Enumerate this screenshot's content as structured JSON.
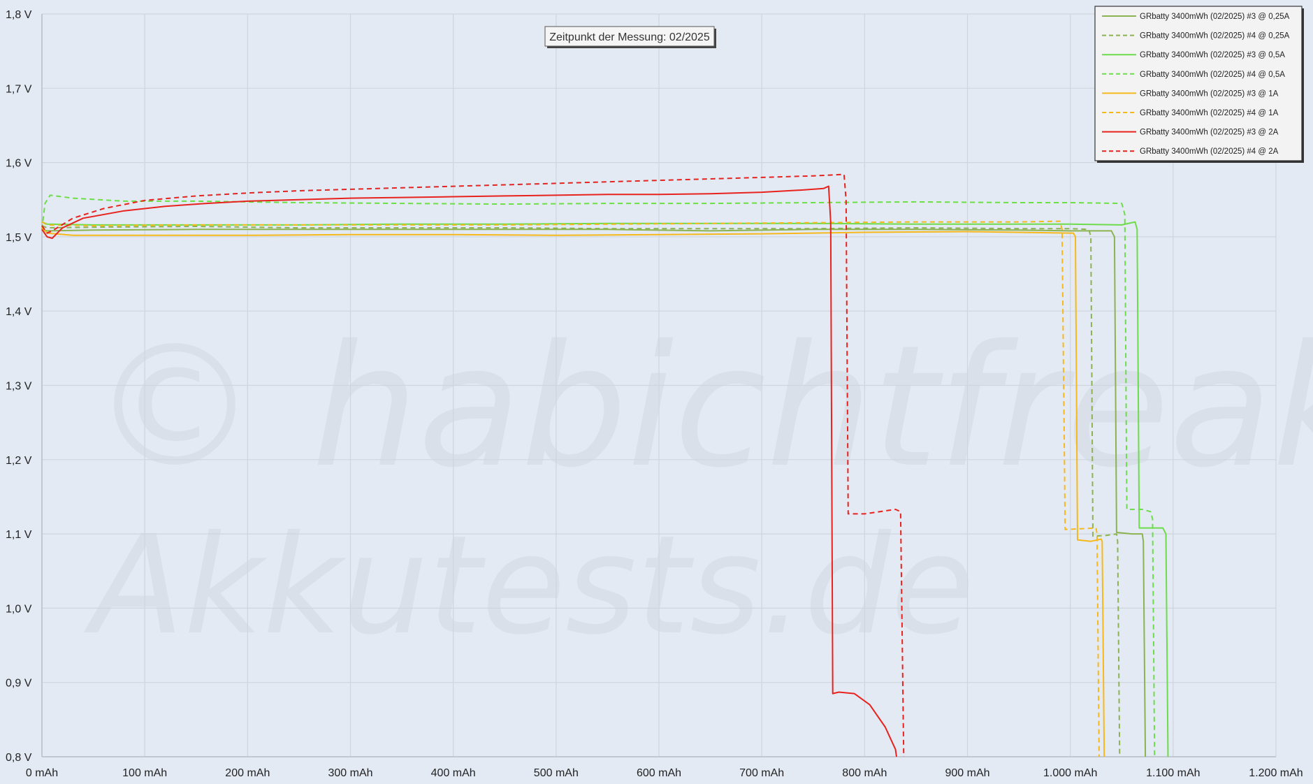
{
  "chart_data": {
    "type": "line",
    "title": "",
    "xlabel": "",
    "ylabel": "",
    "xlim": [
      0,
      1200
    ],
    "ylim": [
      0.8,
      1.8
    ],
    "grid": true,
    "legend_position": "top-right",
    "x_ticks": [
      {
        "value": 0,
        "label": "0 mAh"
      },
      {
        "value": 100,
        "label": "100 mAh"
      },
      {
        "value": 200,
        "label": "200 mAh"
      },
      {
        "value": 300,
        "label": "300 mAh"
      },
      {
        "value": 400,
        "label": "400 mAh"
      },
      {
        "value": 500,
        "label": "500 mAh"
      },
      {
        "value": 600,
        "label": "600 mAh"
      },
      {
        "value": 700,
        "label": "700 mAh"
      },
      {
        "value": 800,
        "label": "800 mAh"
      },
      {
        "value": 900,
        "label": "900 mAh"
      },
      {
        "value": 1000,
        "label": "1.000 mAh"
      },
      {
        "value": 1100,
        "label": "1.100 mAh"
      },
      {
        "value": 1200,
        "label": "1.200 mAh"
      }
    ],
    "y_ticks": [
      {
        "value": 0.8,
        "label": "0,8 V"
      },
      {
        "value": 0.9,
        "label": "0,9 V"
      },
      {
        "value": 1.0,
        "label": "1,0 V"
      },
      {
        "value": 1.1,
        "label": "1,1 V"
      },
      {
        "value": 1.2,
        "label": "1,2 V"
      },
      {
        "value": 1.3,
        "label": "1,3 V"
      },
      {
        "value": 1.4,
        "label": "1,4 V"
      },
      {
        "value": 1.5,
        "label": "1,5 V"
      },
      {
        "value": 1.6,
        "label": "1,6 V"
      },
      {
        "value": 1.7,
        "label": "1,7 V"
      },
      {
        "value": 1.8,
        "label": "1,8 V"
      }
    ],
    "annotation": "Zeitpunkt der Messung: 02/2025",
    "watermark": [
      "© habichtfreak",
      "Akkutests.de"
    ],
    "series": [
      {
        "name": "GRbatty 3400mWh (02/2025) #3 @ 0,25A",
        "color": "#8cb34f",
        "dash": false,
        "points": [
          [
            0,
            1.51
          ],
          [
            5,
            1.508
          ],
          [
            50,
            1.509
          ],
          [
            150,
            1.51
          ],
          [
            250,
            1.51
          ],
          [
            350,
            1.51
          ],
          [
            450,
            1.51
          ],
          [
            550,
            1.51
          ],
          [
            650,
            1.508
          ],
          [
            750,
            1.51
          ],
          [
            850,
            1.51
          ],
          [
            950,
            1.509
          ],
          [
            1000,
            1.508
          ],
          [
            1040,
            1.508
          ],
          [
            1043,
            1.5
          ],
          [
            1045,
            1.102
          ],
          [
            1060,
            1.1
          ],
          [
            1070,
            1.1
          ],
          [
            1071,
            1.09
          ],
          [
            1073,
            0.8
          ]
        ]
      },
      {
        "name": "GRbatty 3400mWh (02/2025) #4 @ 0,25A",
        "color": "#8cb34f",
        "dash": true,
        "points": [
          [
            0,
            1.515
          ],
          [
            5,
            1.512
          ],
          [
            50,
            1.513
          ],
          [
            150,
            1.514
          ],
          [
            250,
            1.512
          ],
          [
            350,
            1.512
          ],
          [
            450,
            1.512
          ],
          [
            550,
            1.511
          ],
          [
            650,
            1.511
          ],
          [
            750,
            1.511
          ],
          [
            850,
            1.512
          ],
          [
            950,
            1.511
          ],
          [
            1000,
            1.511
          ],
          [
            1018,
            1.51
          ],
          [
            1020,
            1.5
          ],
          [
            1022,
            1.097
          ],
          [
            1035,
            1.098
          ],
          [
            1045,
            1.1
          ],
          [
            1046,
            1.09
          ],
          [
            1048,
            0.8
          ]
        ]
      },
      {
        "name": "GRbatty 3400mWh (02/2025) #3 @ 0,5A",
        "color": "#6ddc4a",
        "dash": false,
        "points": [
          [
            0,
            1.52
          ],
          [
            5,
            1.517
          ],
          [
            50,
            1.516
          ],
          [
            150,
            1.516
          ],
          [
            250,
            1.516
          ],
          [
            350,
            1.517
          ],
          [
            450,
            1.517
          ],
          [
            550,
            1.518
          ],
          [
            650,
            1.518
          ],
          [
            750,
            1.518
          ],
          [
            850,
            1.517
          ],
          [
            950,
            1.517
          ],
          [
            1000,
            1.517
          ],
          [
            1050,
            1.516
          ],
          [
            1063,
            1.52
          ],
          [
            1065,
            1.51
          ],
          [
            1067,
            1.108
          ],
          [
            1090,
            1.108
          ],
          [
            1093,
            1.1
          ],
          [
            1095,
            0.8
          ]
        ]
      },
      {
        "name": "GRbatty 3400mWh (02/2025) #4 @ 0,5A",
        "color": "#6ddc4a",
        "dash": true,
        "points": [
          [
            0,
            1.51
          ],
          [
            3,
            1.545
          ],
          [
            8,
            1.556
          ],
          [
            30,
            1.552
          ],
          [
            80,
            1.548
          ],
          [
            150,
            1.548
          ],
          [
            250,
            1.546
          ],
          [
            350,
            1.545
          ],
          [
            450,
            1.544
          ],
          [
            550,
            1.545
          ],
          [
            650,
            1.545
          ],
          [
            750,
            1.546
          ],
          [
            850,
            1.547
          ],
          [
            950,
            1.546
          ],
          [
            1000,
            1.546
          ],
          [
            1050,
            1.545
          ],
          [
            1053,
            1.53
          ],
          [
            1055,
            1.133
          ],
          [
            1070,
            1.133
          ],
          [
            1078,
            1.13
          ],
          [
            1080,
            1.12
          ],
          [
            1082,
            0.8
          ]
        ]
      },
      {
        "name": "GRbatty 3400mWh (02/2025) #3 @ 1A",
        "color": "#f6b81a",
        "dash": false,
        "points": [
          [
            0,
            1.512
          ],
          [
            5,
            1.505
          ],
          [
            30,
            1.502
          ],
          [
            100,
            1.502
          ],
          [
            200,
            1.502
          ],
          [
            300,
            1.503
          ],
          [
            400,
            1.503
          ],
          [
            500,
            1.502
          ],
          [
            600,
            1.503
          ],
          [
            700,
            1.504
          ],
          [
            800,
            1.506
          ],
          [
            900,
            1.507
          ],
          [
            1000,
            1.505
          ],
          [
            1003,
            1.505
          ],
          [
            1005,
            1.5
          ],
          [
            1007,
            1.092
          ],
          [
            1020,
            1.09
          ],
          [
            1030,
            1.093
          ],
          [
            1031,
            1.09
          ],
          [
            1033,
            0.8
          ]
        ]
      },
      {
        "name": "GRbatty 3400mWh (02/2025) #4 @ 1A",
        "color": "#f6b81a",
        "dash": true,
        "points": [
          [
            0,
            1.52
          ],
          [
            5,
            1.516
          ],
          [
            50,
            1.515
          ],
          [
            150,
            1.516
          ],
          [
            250,
            1.516
          ],
          [
            350,
            1.516
          ],
          [
            450,
            1.516
          ],
          [
            550,
            1.517
          ],
          [
            650,
            1.518
          ],
          [
            750,
            1.519
          ],
          [
            850,
            1.52
          ],
          [
            950,
            1.52
          ],
          [
            990,
            1.521
          ],
          [
            992,
            1.51
          ],
          [
            995,
            1.106
          ],
          [
            1010,
            1.107
          ],
          [
            1025,
            1.108
          ],
          [
            1026,
            1.1
          ],
          [
            1028,
            0.8
          ]
        ]
      },
      {
        "name": "GRbatty 3400mWh (02/2025) #3 @ 2A",
        "color": "#e8221c",
        "dash": false,
        "points": [
          [
            0,
            1.51
          ],
          [
            5,
            1.5
          ],
          [
            10,
            1.498
          ],
          [
            20,
            1.512
          ],
          [
            40,
            1.525
          ],
          [
            80,
            1.535
          ],
          [
            120,
            1.541
          ],
          [
            160,
            1.545
          ],
          [
            200,
            1.548
          ],
          [
            250,
            1.55
          ],
          [
            300,
            1.552
          ],
          [
            350,
            1.553
          ],
          [
            400,
            1.554
          ],
          [
            450,
            1.555
          ],
          [
            500,
            1.556
          ],
          [
            550,
            1.557
          ],
          [
            600,
            1.557
          ],
          [
            650,
            1.558
          ],
          [
            700,
            1.56
          ],
          [
            740,
            1.563
          ],
          [
            760,
            1.565
          ],
          [
            765,
            1.568
          ],
          [
            767,
            1.52
          ],
          [
            769,
            0.885
          ],
          [
            775,
            0.887
          ],
          [
            790,
            0.885
          ],
          [
            805,
            0.87
          ],
          [
            820,
            0.84
          ],
          [
            830,
            0.81
          ],
          [
            831,
            0.8
          ]
        ]
      },
      {
        "name": "GRbatty 3400mWh (02/2025) #4 @ 2A",
        "color": "#e8221c",
        "dash": true,
        "points": [
          [
            0,
            1.515
          ],
          [
            5,
            1.505
          ],
          [
            10,
            1.508
          ],
          [
            30,
            1.525
          ],
          [
            60,
            1.538
          ],
          [
            100,
            1.549
          ],
          [
            150,
            1.555
          ],
          [
            200,
            1.559
          ],
          [
            250,
            1.562
          ],
          [
            300,
            1.564
          ],
          [
            350,
            1.566
          ],
          [
            400,
            1.568
          ],
          [
            450,
            1.57
          ],
          [
            500,
            1.572
          ],
          [
            550,
            1.574
          ],
          [
            600,
            1.576
          ],
          [
            650,
            1.578
          ],
          [
            700,
            1.58
          ],
          [
            750,
            1.582
          ],
          [
            780,
            1.584
          ],
          [
            782,
            1.55
          ],
          [
            784,
            1.127
          ],
          [
            800,
            1.127
          ],
          [
            830,
            1.133
          ],
          [
            835,
            1.13
          ],
          [
            838,
            0.8
          ]
        ]
      }
    ]
  }
}
